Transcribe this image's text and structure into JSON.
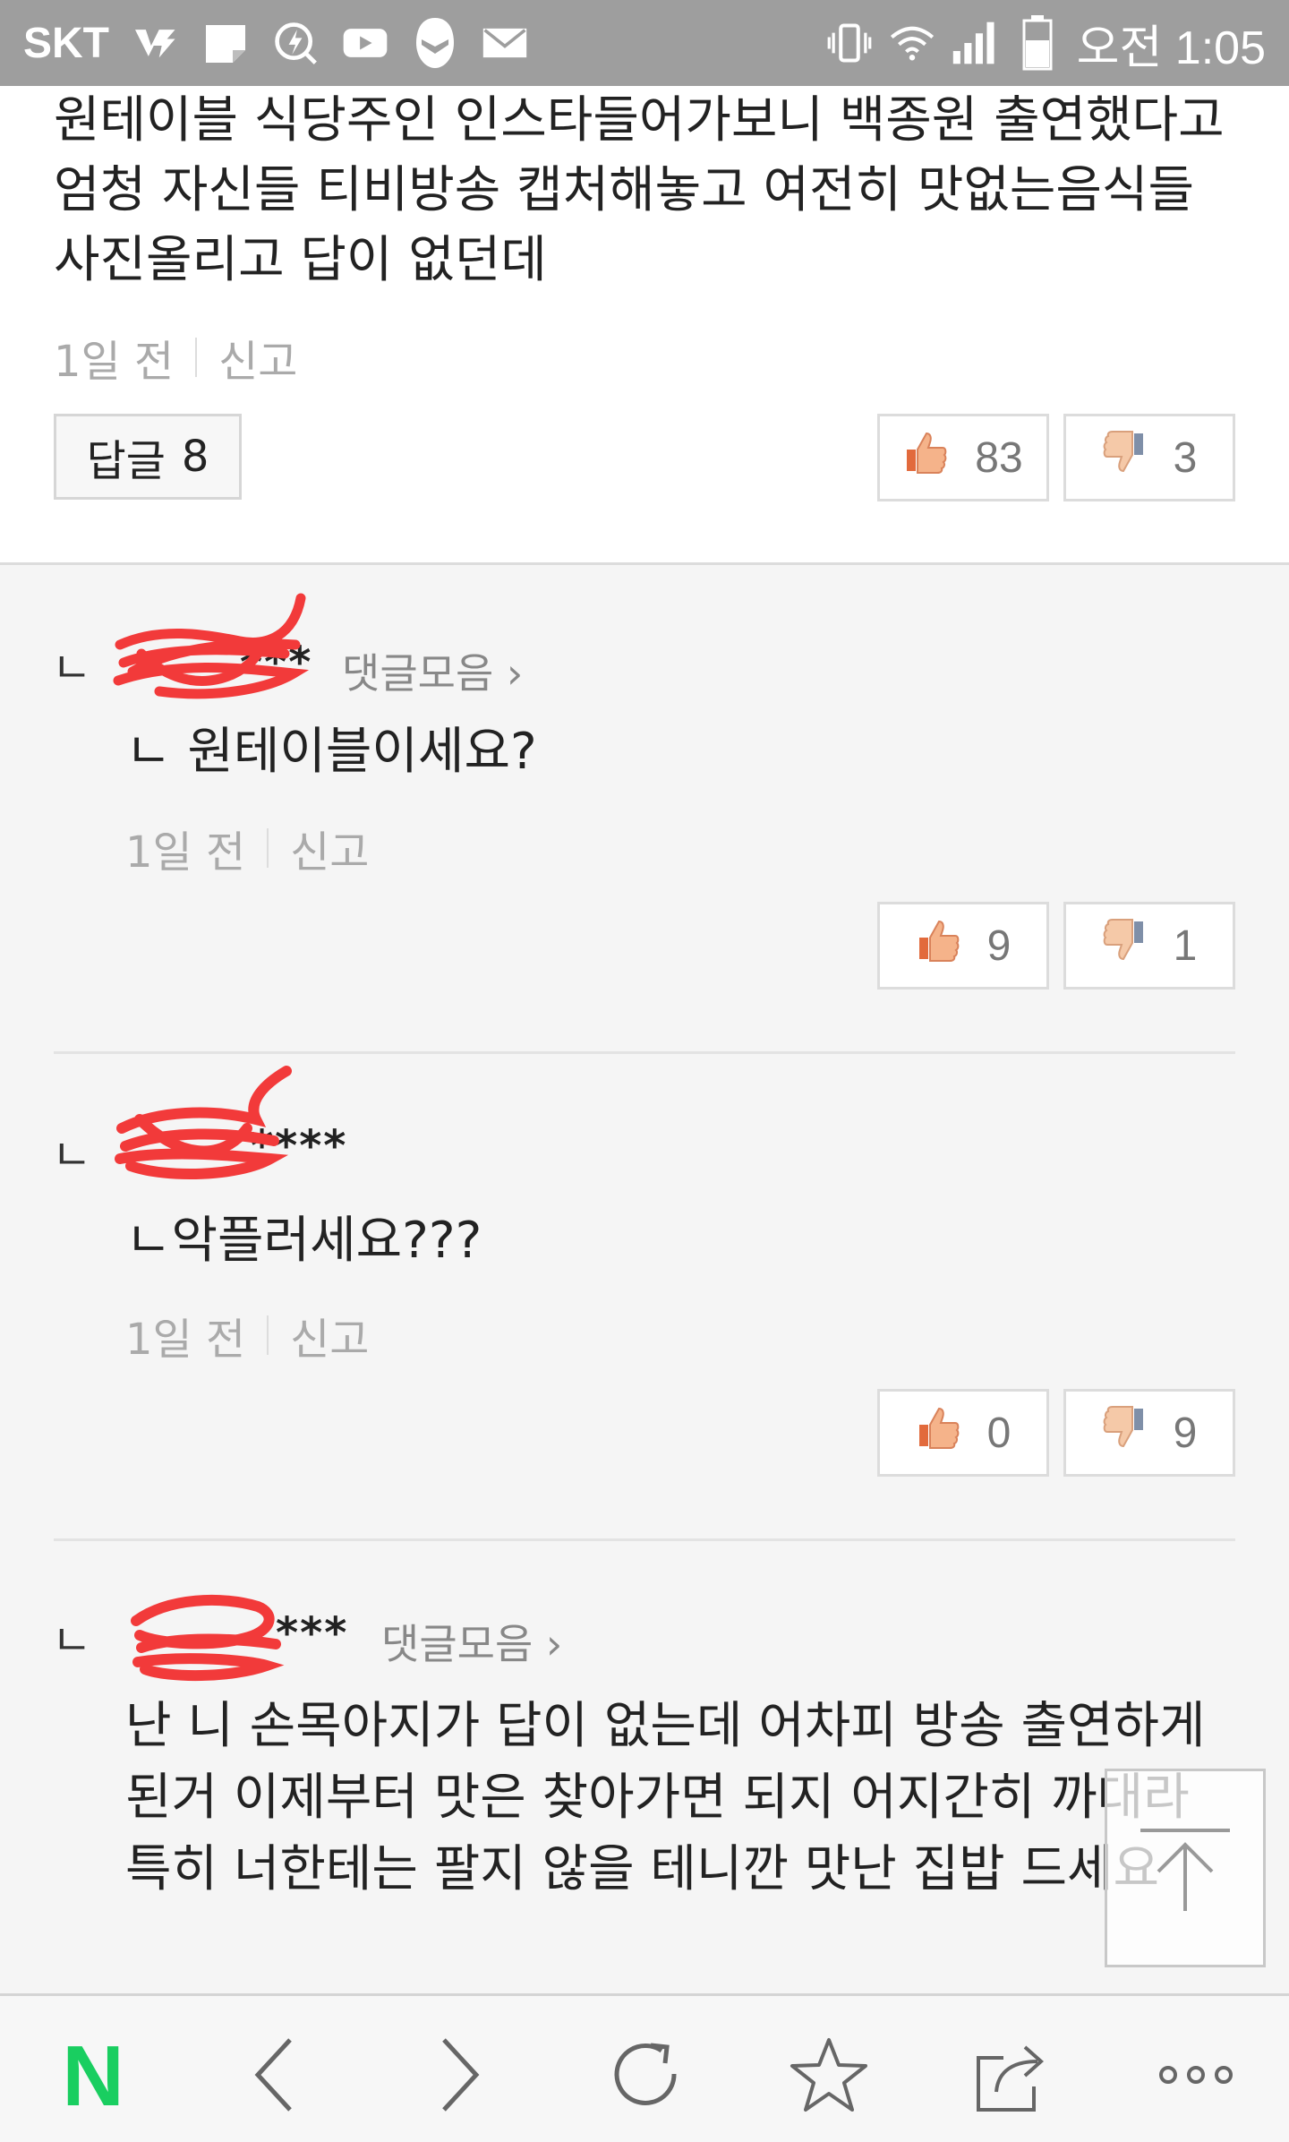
{
  "status_bar": {
    "carrier": "SKT",
    "time": "오전 1:05"
  },
  "top_comment": {
    "text": "원테이블 식당주인 인스타들어가보니 백종원 출연했다고 엄청 자신들 티비방송 캡처해놓고 여전히 맛없는음식들 사진올리고 답이 없던데",
    "time": "1일 전",
    "report": "신고",
    "reply_label": "답글",
    "reply_count": "8",
    "likes": "83",
    "dislikes": "3"
  },
  "replies": [
    {
      "mark": "ㄴ",
      "nick": "***",
      "collect": "댓글모음 ›",
      "text": "ㄴ 원테이블이세요?",
      "time": "1일 전",
      "report": "신고",
      "likes": "9",
      "dislikes": "1"
    },
    {
      "mark": "ㄴ",
      "nick": "****",
      "collect": "",
      "text": "ㄴ악플러세요???",
      "time": "1일 전",
      "report": "신고",
      "likes": "0",
      "dislikes": "9"
    },
    {
      "mark": "ㄴ",
      "nick": "***",
      "collect": "댓글모음 ›",
      "text": "난 니 손목아지가 답이 없는데 어차피 방송 출연하게 된거 이제부터 맛은 찾아가면 되지 어지간히 까대라 특히 너한테는 팔지 않을 테니깐 맛난 집밥 드세요"
    }
  ],
  "colors": {
    "status_bar": "#9e9e9e",
    "brand_green": "#19ce60",
    "scribble_red": "#f23a3a"
  },
  "icons": [
    "back-icon",
    "forward-icon",
    "refresh-icon",
    "bookmark-star-icon",
    "share-icon",
    "more-icon",
    "scroll-top-icon",
    "thumbs-up-icon",
    "thumbs-down-icon"
  ]
}
